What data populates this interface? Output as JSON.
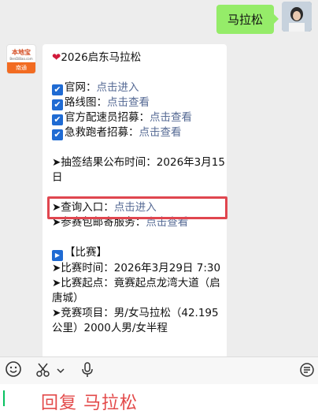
{
  "user_message": {
    "text": "马拉松"
  },
  "bot_avatar": {
    "brand": "本地宝",
    "brand_sub": "BenDiBao.com",
    "city": "南通"
  },
  "message": {
    "title": "2026启东马拉松",
    "links": [
      {
        "label": "官网：",
        "link": "点击进入"
      },
      {
        "label": "路线图：",
        "link": "点击查看"
      },
      {
        "label": "官方配速员招募：",
        "link": "点击查看"
      },
      {
        "label": "急救跑者招募：",
        "link": "点击查看"
      }
    ],
    "lottery_label": "➤抽签结果公布时间：2026年3月15日",
    "query_label": "➤查询入口：",
    "query_link": "点击进入",
    "mail_label": "➤参赛包邮寄服务：",
    "mail_link": "点击查看",
    "race_header": "【比赛】",
    "race_time": "➤比赛时间：2026年3月29日 7:30",
    "race_start": "➤比赛起点：竟赛起点龙湾大道（启唐城）",
    "race_items": "➤竞赛项目：男/女马拉松（42.195公里）2000人男/女半程"
  },
  "compose": {
    "text": "回复 马拉松"
  },
  "icons": [
    "emoji-icon",
    "scissors-icon",
    "chevron-down-icon",
    "microphone-icon",
    "more-icon"
  ]
}
